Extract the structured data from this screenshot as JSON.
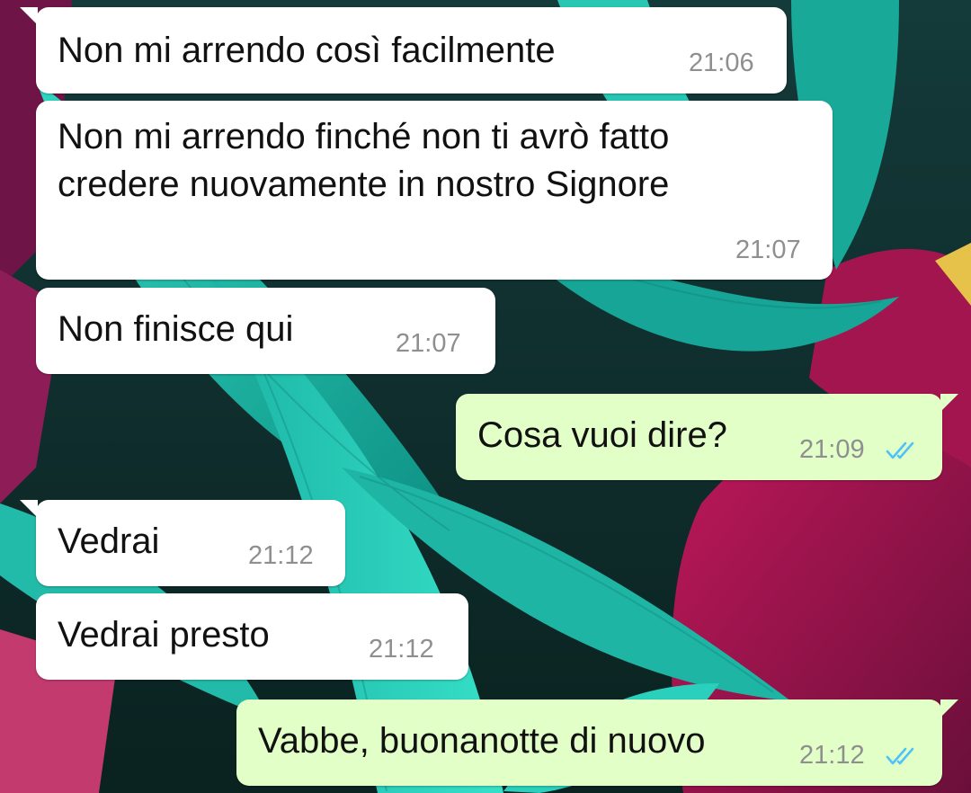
{
  "chat": {
    "colors": {
      "incoming_bubble": "#ffffff",
      "outgoing_bubble": "#e1ffc7",
      "time_text": "#8f8f8f",
      "read_ticks": "#4fc3f7"
    },
    "messages": [
      {
        "direction": "incoming",
        "text": "Non mi arrendo così facilmente",
        "time": "21:06"
      },
      {
        "direction": "incoming",
        "text": "Non mi arrendo finché non ti avrò fatto\ncredere nuovamente in nostro Signore",
        "time": "21:07"
      },
      {
        "direction": "incoming",
        "text": "Non finisce qui",
        "time": "21:07"
      },
      {
        "direction": "outgoing",
        "text": "Cosa vuoi dire?",
        "time": "21:09",
        "status": "read-ticks-icon"
      },
      {
        "direction": "incoming",
        "text": "Vedrai",
        "time": "21:12"
      },
      {
        "direction": "incoming",
        "text": "Vedrai presto",
        "time": "21:12"
      },
      {
        "direction": "outgoing",
        "text": "Vabbe, buonanotte di nuovo",
        "time": "21:12",
        "status": "read-ticks-icon"
      }
    ]
  }
}
